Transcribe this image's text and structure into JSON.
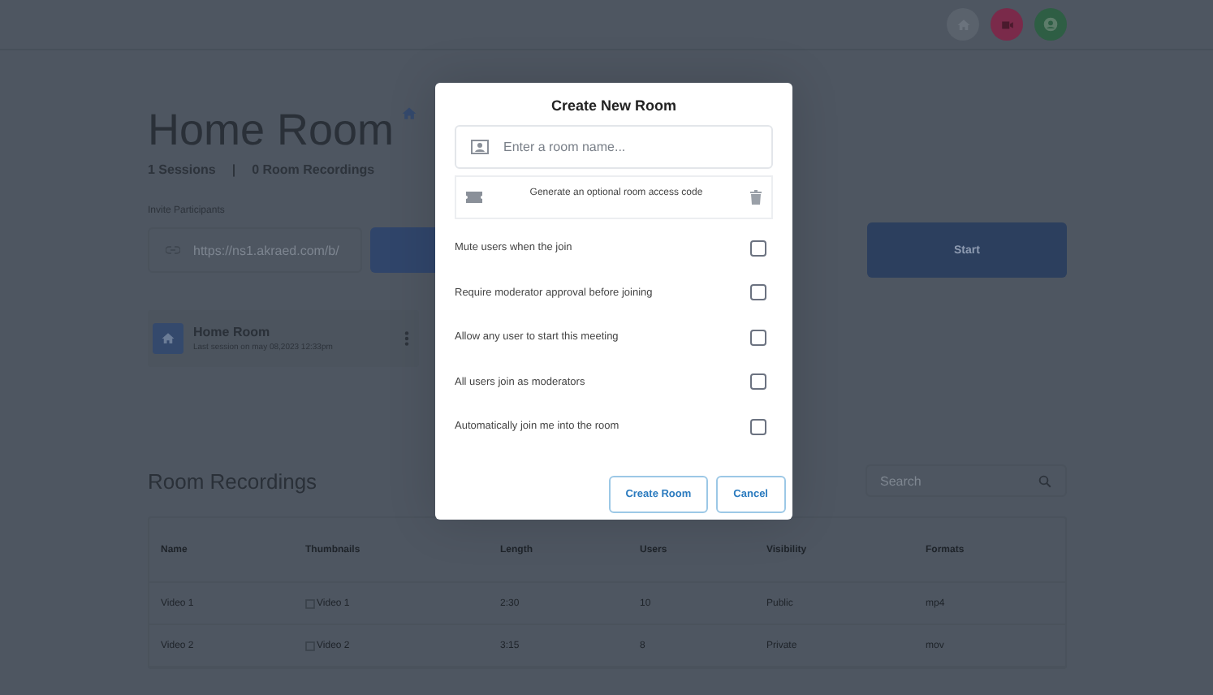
{
  "room": {
    "title": "Home Room",
    "sessions": "1 Sessions",
    "separator": "|",
    "recordings_count": "0 Room Recordings"
  },
  "invite": {
    "label": "Invite Participants",
    "url": "https://ns1.akraed.com/b/",
    "start_button": "Start"
  },
  "room_card": {
    "name": "Home Room",
    "last_session": "Last session on may 08,2023 12:33pm"
  },
  "recordings": {
    "title": "Room Recordings",
    "search": {
      "placeholder": "Search"
    },
    "columns": [
      "Name",
      "Thumbnails",
      "Length",
      "Users",
      "Visibility",
      "Formats"
    ],
    "rows": [
      {
        "cells": [
          "Video 1",
          "Video 1",
          "2:30",
          "10",
          "Public",
          "mp4"
        ]
      },
      {
        "cells": [
          "Video 2",
          "Video 2",
          "3:15",
          "8",
          "Private",
          "mov"
        ]
      }
    ]
  },
  "dialog": {
    "title": "Create New Room",
    "name_field": {
      "placeholder": "Enter a room name..."
    },
    "access_code": "Generate an optional room access code",
    "options": [
      {
        "label": "Mute users when the join",
        "checked": false
      },
      {
        "label": "Require moderator approval before joining",
        "checked": false
      },
      {
        "label": "Allow any user to start this meeting",
        "checked": false
      },
      {
        "label": "All users join as moderators",
        "checked": false
      },
      {
        "label": "Automatically join me into the room",
        "checked": false
      }
    ],
    "buttons": [
      "Create Room",
      "Cancel"
    ]
  }
}
